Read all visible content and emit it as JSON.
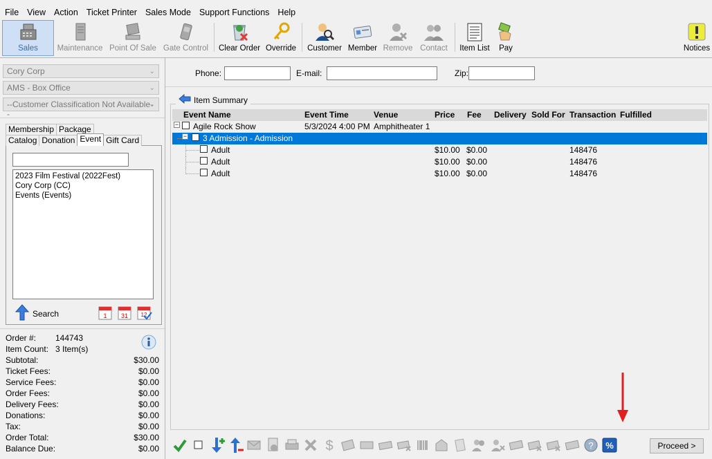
{
  "menu": [
    "File",
    "View",
    "Action",
    "Ticket Printer",
    "Sales Mode",
    "Support Functions",
    "Help"
  ],
  "toolbar": {
    "sales": "Sales",
    "maintenance": "Maintenance",
    "point_of_sale": "Point Of Sale",
    "gate_control": "Gate Control",
    "clear_order": "Clear Order",
    "override": "Override",
    "customer": "Customer",
    "member": "Member",
    "remove": "Remove",
    "contact": "Contact",
    "item_list": "Item List",
    "pay": "Pay",
    "notices": "Notices"
  },
  "left": {
    "combo1": "Cory Corp",
    "combo2": "AMS - Box Office",
    "combo3": "--Customer Classification Not Available--",
    "tabs_row1": [
      "Membership",
      "Package"
    ],
    "tabs_row2": [
      "Catalog",
      "Donation",
      "Event",
      "Gift Card"
    ],
    "list_items": [
      "2023 Film Festival  (2022Fest)",
      "Cory Corp  (CC)",
      "Events  (Events)"
    ],
    "search_label": "Search",
    "calendar_icons": {
      "cal1": "1",
      "cal2": "31",
      "cal3": "12"
    }
  },
  "summary": {
    "order_label": "Order #:",
    "order_value": "144743",
    "item_count_label": "Item Count:",
    "item_count_value": "3 Item(s)",
    "rows": [
      {
        "label": "Subtotal:",
        "value": "$30.00"
      },
      {
        "label": "Ticket Fees:",
        "value": "$0.00"
      },
      {
        "label": "Service Fees:",
        "value": "$0.00"
      },
      {
        "label": "Order Fees:",
        "value": "$0.00"
      },
      {
        "label": "Delivery Fees:",
        "value": "$0.00"
      },
      {
        "label": "Donations:",
        "value": "$0.00"
      },
      {
        "label": "Tax:",
        "value": "$0.00"
      },
      {
        "label": "Order Total:",
        "value": "$30.00"
      },
      {
        "label": "Balance Due:",
        "value": "$0.00"
      }
    ]
  },
  "contact": {
    "phone_label": "Phone:",
    "email_label": "E-mail:",
    "zip_label": "Zip:",
    "phone_value": "",
    "email_value": "",
    "zip_value": ""
  },
  "item_summary": {
    "title": "Item Summary",
    "columns": [
      "Event Name",
      "Event Time",
      "Venue",
      "Price",
      "Fee",
      "Delivery",
      "Sold For",
      "Transaction",
      "Fulfilled"
    ],
    "event": {
      "name": "Agile Rock Show",
      "time": "5/3/2024 4:00 PM",
      "venue": "Amphitheater 1"
    },
    "group": {
      "name": "3 Admission - Admission"
    },
    "tickets": [
      {
        "name": "Adult",
        "price": "$10.00",
        "fee": "$0.00",
        "transaction": "148476"
      },
      {
        "name": "Adult",
        "price": "$10.00",
        "fee": "$0.00",
        "transaction": "148476"
      },
      {
        "name": "Adult",
        "price": "$10.00",
        "fee": "$0.00",
        "transaction": "148476"
      }
    ]
  },
  "proceed_label": "Proceed >",
  "discount_icon_text": "%",
  "colors": {
    "selection": "#0078d7",
    "annotation_arrow": "#e02020"
  }
}
